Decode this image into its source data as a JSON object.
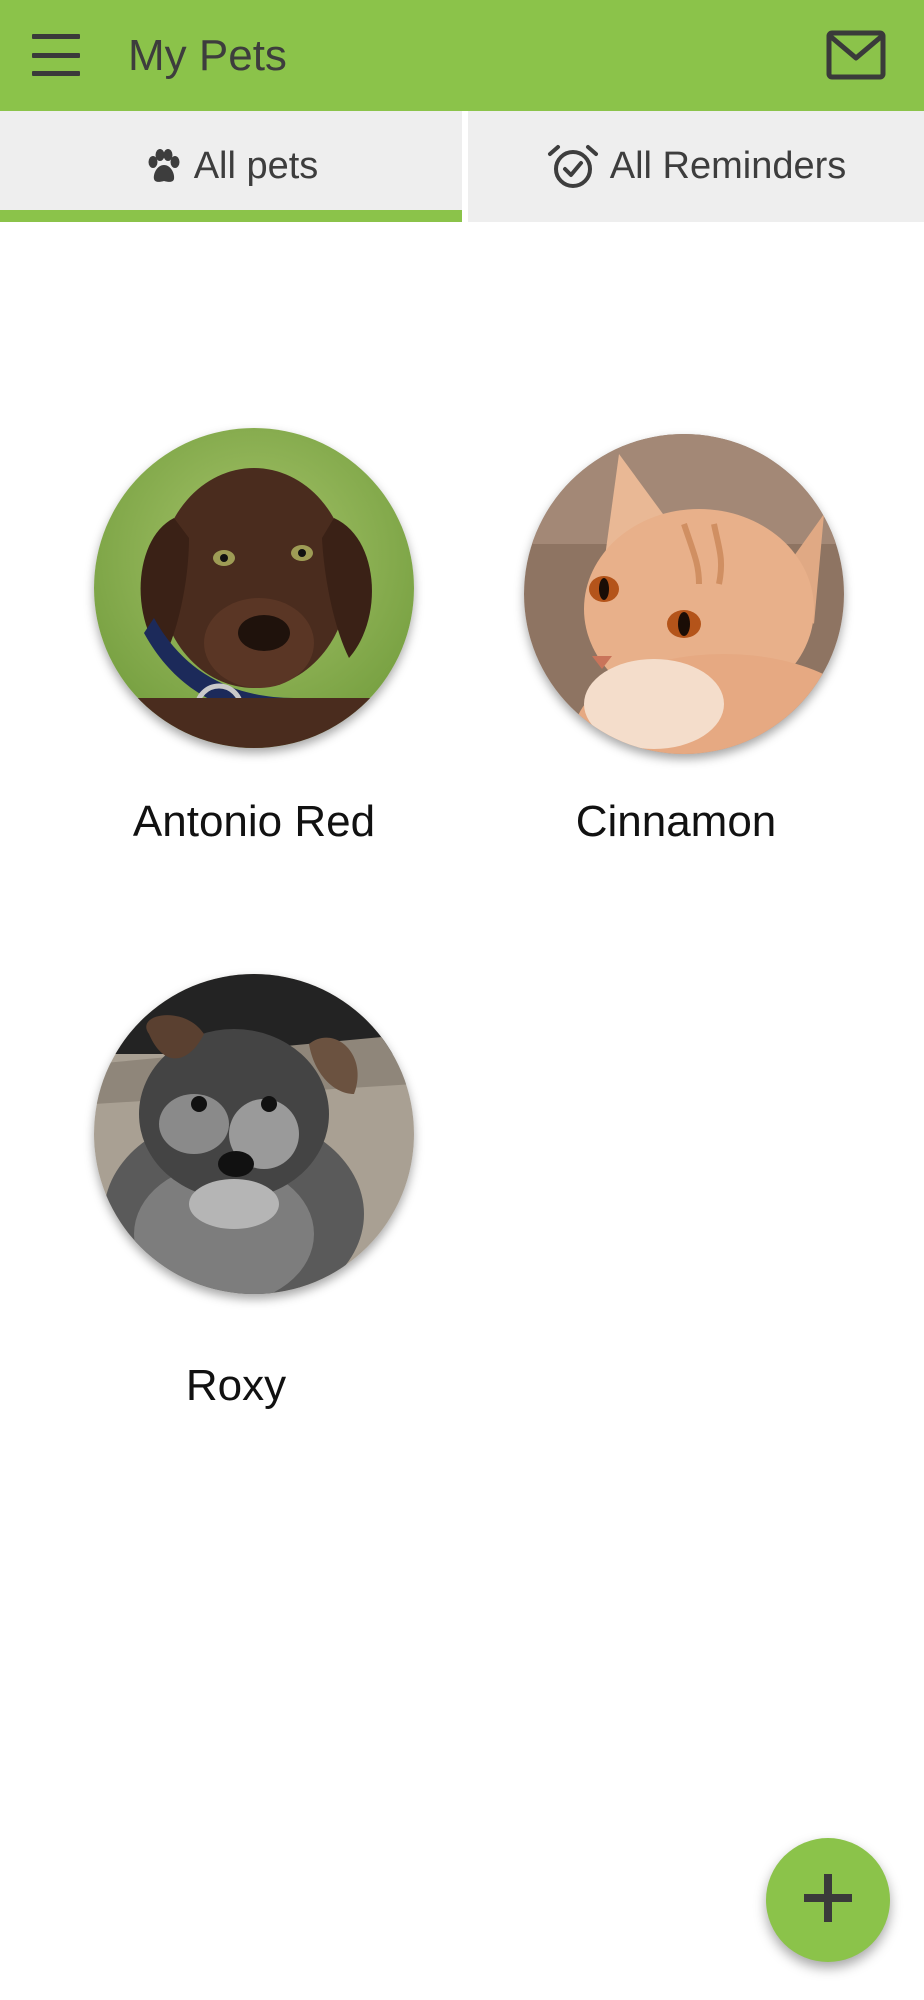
{
  "app_bar": {
    "title": "My Pets",
    "menu_icon": "menu-icon",
    "mail_icon": "mail-icon",
    "background_color": "#8bc34a"
  },
  "tabs": [
    {
      "label": "All pets",
      "icon": "paw-icon",
      "selected": true
    },
    {
      "label": "All Reminders",
      "icon": "alarm-check-icon",
      "selected": false
    }
  ],
  "pets": [
    {
      "name": "Antonio Red",
      "photo": "chocolate-labrador-puppy"
    },
    {
      "name": "Cinnamon",
      "photo": "orange-tabby-cat"
    },
    {
      "name": "Roxy",
      "photo": "schnauzer-puppy"
    }
  ],
  "fab": {
    "icon": "plus-icon"
  },
  "colors": {
    "accent": "#8bc34a",
    "tab_background": "#eeeeee",
    "text_dark": "#3d3d3d"
  }
}
